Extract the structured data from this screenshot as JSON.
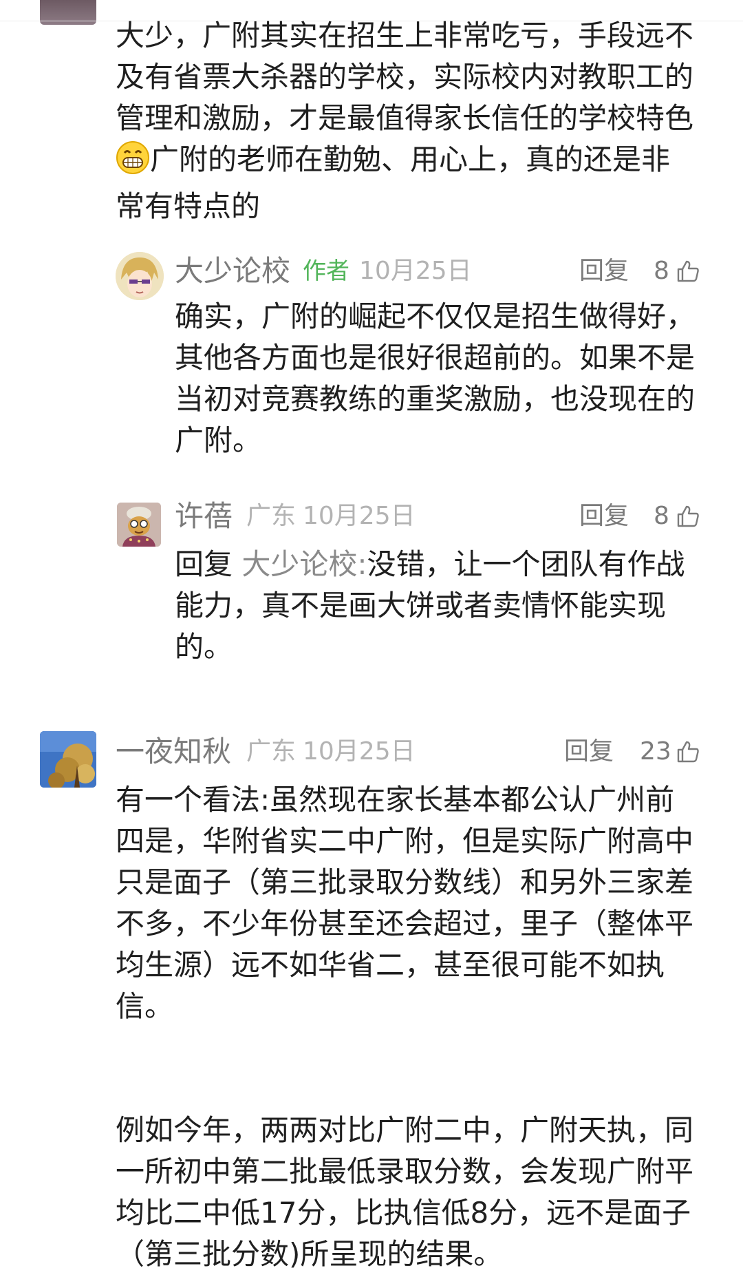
{
  "first_comment": {
    "text_part1": "大少，广附其实在招生上非常吃亏，手段远不及有省票大杀器的学校，实际校内对教职工的管理和激励，才是最值得家长信任的学校特色",
    "emoji_icon": "grinning-face-emoji",
    "text_part2": "广附的老师在勤勉、用心上，真的还是非常有特点的"
  },
  "reply1": {
    "author": "大少论校",
    "author_tag": "作者",
    "date": "10月25日",
    "reply_label": "回复",
    "likes": "8",
    "text": "确实，广附的崛起不仅仅是招生做得好，其他各方面也是很好很超前的。如果不是当初对竞赛教练的重奖激励，也没现在的广附。"
  },
  "reply2": {
    "author": "许蓓",
    "location": "广东",
    "date": "10月25日",
    "reply_label": "回复",
    "likes": "8",
    "reply_prefix": "回复",
    "mention": "大少论校:",
    "text": "没错，让一个团队有作战能力，真不是画大饼或者卖情怀能实现的。"
  },
  "comment2": {
    "author": "一夜知秋",
    "location": "广东",
    "date": "10月25日",
    "reply_label": "回复",
    "likes": "23",
    "paragraph1": "有一个看法:虽然现在家长基本都公认广州前四是，华附省实二中广附，但是实际广附高中只是面子（第三批录取分数线）和另外三家差不多，不少年份甚至还会超过，里子（整体平均生源）远不如华省二，甚至很可能不如执信。",
    "paragraph2": "例如今年，两两对比广附二中，广附天执，同一所初中第二批最低录取分数，会发现广附平均比二中低17分，比执信低8分，远不是面子（第三批分数)所呈现的结果。"
  },
  "icons": {
    "like": "thumbs-up-icon"
  },
  "colors": {
    "author_tag": "#52b55a",
    "meta_gray": "#b3b3b3",
    "name_gray": "#7b7b7b",
    "text": "#1f1f1f"
  }
}
